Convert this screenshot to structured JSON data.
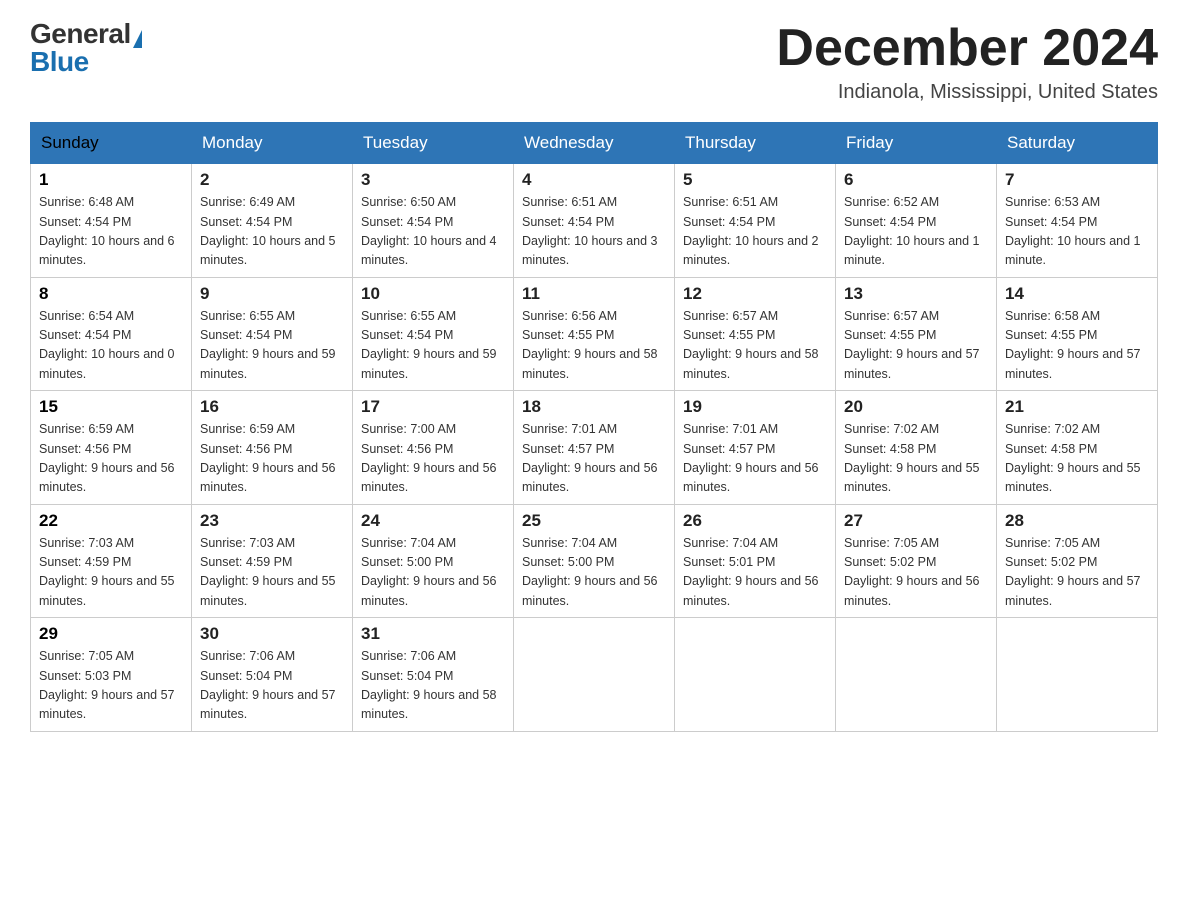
{
  "header": {
    "logo_general": "General",
    "logo_blue": "Blue",
    "month_title": "December 2024",
    "location": "Indianola, Mississippi, United States"
  },
  "weekdays": [
    "Sunday",
    "Monday",
    "Tuesday",
    "Wednesday",
    "Thursday",
    "Friday",
    "Saturday"
  ],
  "weeks": [
    [
      {
        "day": "1",
        "sunrise": "6:48 AM",
        "sunset": "4:54 PM",
        "daylight": "10 hours and 6 minutes."
      },
      {
        "day": "2",
        "sunrise": "6:49 AM",
        "sunset": "4:54 PM",
        "daylight": "10 hours and 5 minutes."
      },
      {
        "day": "3",
        "sunrise": "6:50 AM",
        "sunset": "4:54 PM",
        "daylight": "10 hours and 4 minutes."
      },
      {
        "day": "4",
        "sunrise": "6:51 AM",
        "sunset": "4:54 PM",
        "daylight": "10 hours and 3 minutes."
      },
      {
        "day": "5",
        "sunrise": "6:51 AM",
        "sunset": "4:54 PM",
        "daylight": "10 hours and 2 minutes."
      },
      {
        "day": "6",
        "sunrise": "6:52 AM",
        "sunset": "4:54 PM",
        "daylight": "10 hours and 1 minute."
      },
      {
        "day": "7",
        "sunrise": "6:53 AM",
        "sunset": "4:54 PM",
        "daylight": "10 hours and 1 minute."
      }
    ],
    [
      {
        "day": "8",
        "sunrise": "6:54 AM",
        "sunset": "4:54 PM",
        "daylight": "10 hours and 0 minutes."
      },
      {
        "day": "9",
        "sunrise": "6:55 AM",
        "sunset": "4:54 PM",
        "daylight": "9 hours and 59 minutes."
      },
      {
        "day": "10",
        "sunrise": "6:55 AM",
        "sunset": "4:54 PM",
        "daylight": "9 hours and 59 minutes."
      },
      {
        "day": "11",
        "sunrise": "6:56 AM",
        "sunset": "4:55 PM",
        "daylight": "9 hours and 58 minutes."
      },
      {
        "day": "12",
        "sunrise": "6:57 AM",
        "sunset": "4:55 PM",
        "daylight": "9 hours and 58 minutes."
      },
      {
        "day": "13",
        "sunrise": "6:57 AM",
        "sunset": "4:55 PM",
        "daylight": "9 hours and 57 minutes."
      },
      {
        "day": "14",
        "sunrise": "6:58 AM",
        "sunset": "4:55 PM",
        "daylight": "9 hours and 57 minutes."
      }
    ],
    [
      {
        "day": "15",
        "sunrise": "6:59 AM",
        "sunset": "4:56 PM",
        "daylight": "9 hours and 56 minutes."
      },
      {
        "day": "16",
        "sunrise": "6:59 AM",
        "sunset": "4:56 PM",
        "daylight": "9 hours and 56 minutes."
      },
      {
        "day": "17",
        "sunrise": "7:00 AM",
        "sunset": "4:56 PM",
        "daylight": "9 hours and 56 minutes."
      },
      {
        "day": "18",
        "sunrise": "7:01 AM",
        "sunset": "4:57 PM",
        "daylight": "9 hours and 56 minutes."
      },
      {
        "day": "19",
        "sunrise": "7:01 AM",
        "sunset": "4:57 PM",
        "daylight": "9 hours and 56 minutes."
      },
      {
        "day": "20",
        "sunrise": "7:02 AM",
        "sunset": "4:58 PM",
        "daylight": "9 hours and 55 minutes."
      },
      {
        "day": "21",
        "sunrise": "7:02 AM",
        "sunset": "4:58 PM",
        "daylight": "9 hours and 55 minutes."
      }
    ],
    [
      {
        "day": "22",
        "sunrise": "7:03 AM",
        "sunset": "4:59 PM",
        "daylight": "9 hours and 55 minutes."
      },
      {
        "day": "23",
        "sunrise": "7:03 AM",
        "sunset": "4:59 PM",
        "daylight": "9 hours and 55 minutes."
      },
      {
        "day": "24",
        "sunrise": "7:04 AM",
        "sunset": "5:00 PM",
        "daylight": "9 hours and 56 minutes."
      },
      {
        "day": "25",
        "sunrise": "7:04 AM",
        "sunset": "5:00 PM",
        "daylight": "9 hours and 56 minutes."
      },
      {
        "day": "26",
        "sunrise": "7:04 AM",
        "sunset": "5:01 PM",
        "daylight": "9 hours and 56 minutes."
      },
      {
        "day": "27",
        "sunrise": "7:05 AM",
        "sunset": "5:02 PM",
        "daylight": "9 hours and 56 minutes."
      },
      {
        "day": "28",
        "sunrise": "7:05 AM",
        "sunset": "5:02 PM",
        "daylight": "9 hours and 57 minutes."
      }
    ],
    [
      {
        "day": "29",
        "sunrise": "7:05 AM",
        "sunset": "5:03 PM",
        "daylight": "9 hours and 57 minutes."
      },
      {
        "day": "30",
        "sunrise": "7:06 AM",
        "sunset": "5:04 PM",
        "daylight": "9 hours and 57 minutes."
      },
      {
        "day": "31",
        "sunrise": "7:06 AM",
        "sunset": "5:04 PM",
        "daylight": "9 hours and 58 minutes."
      },
      null,
      null,
      null,
      null
    ]
  ],
  "labels": {
    "sunrise": "Sunrise:",
    "sunset": "Sunset:",
    "daylight": "Daylight:"
  }
}
